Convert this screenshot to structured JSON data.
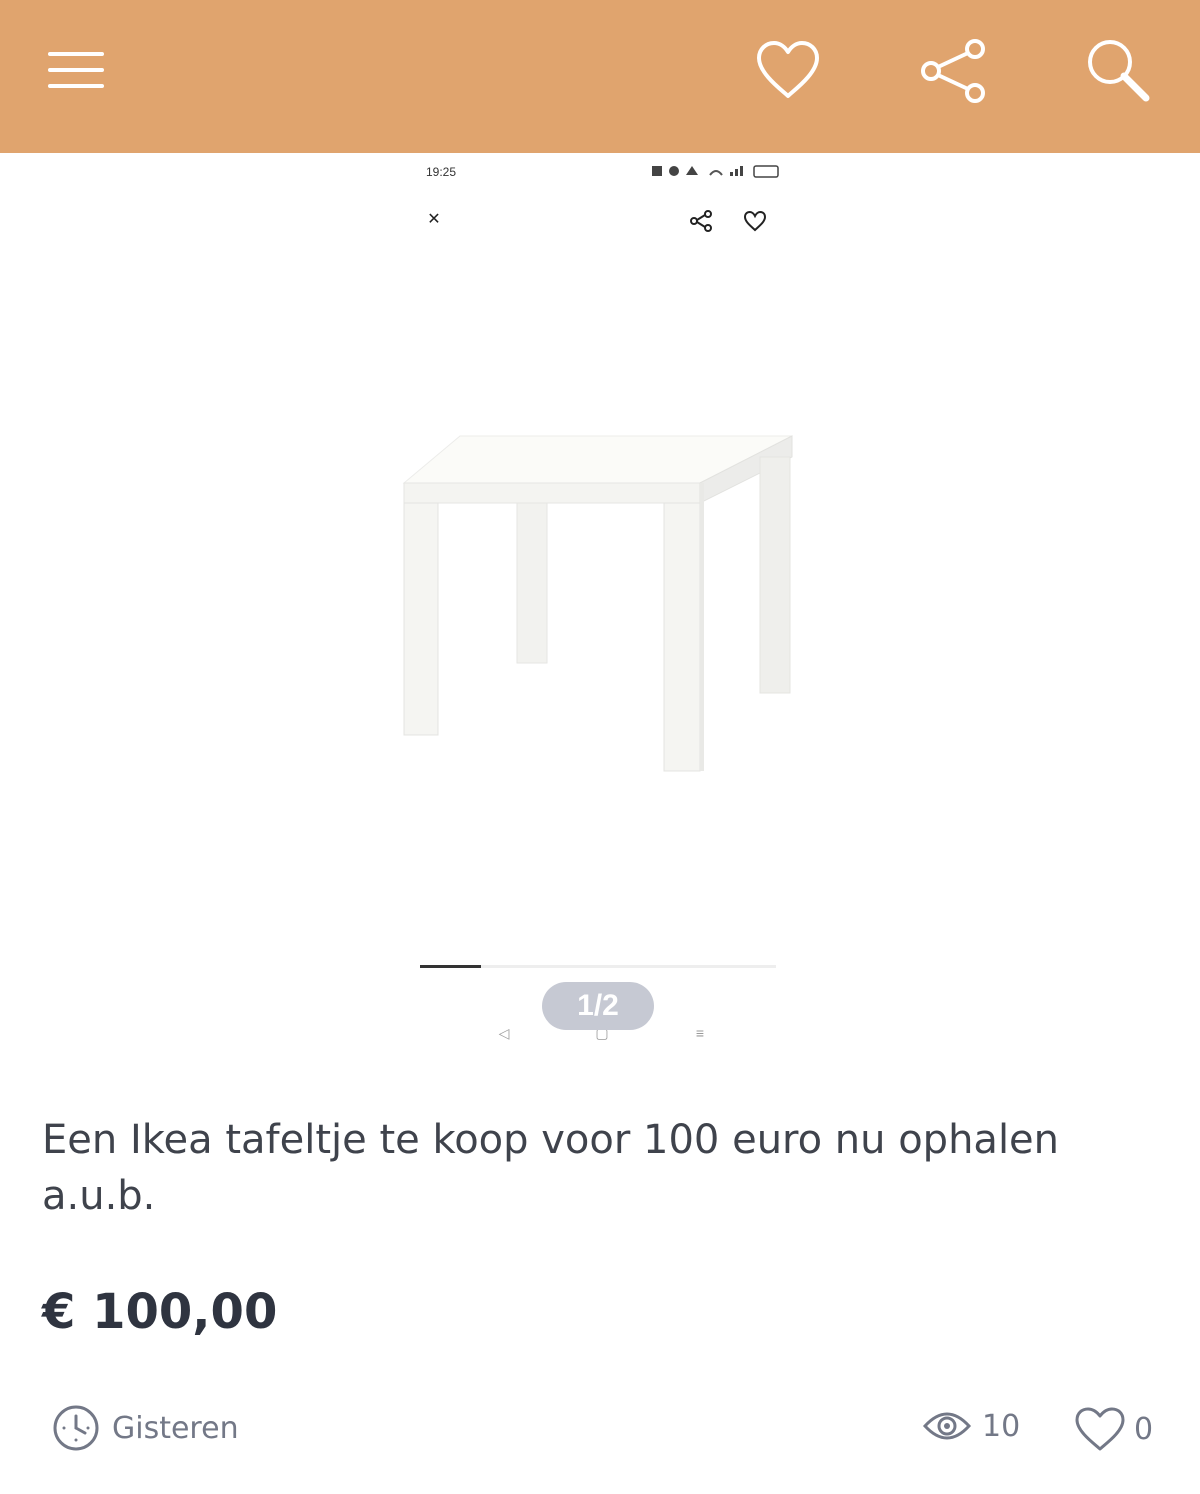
{
  "colors": {
    "header_background": "#e0a46e",
    "header_icons": "#ffffff",
    "text_primary": "#3f434c",
    "text_meta": "#737887",
    "counter_badge": "#c6c9d3"
  },
  "header": {
    "icons": [
      "menu-icon",
      "heart-icon",
      "share-icon",
      "search-icon"
    ]
  },
  "screenshot": {
    "status_time": "19:25",
    "icons": [
      "close-icon",
      "share-icon",
      "heart-icon"
    ],
    "image_progress": 0.17
  },
  "gallery": {
    "counter": "1/2"
  },
  "listing": {
    "title": "Een Ikea tafeltje te koop voor 100 euro nu ophalen a.u.b.",
    "price": "€ 100,00",
    "posted": "Gisteren",
    "views": "10",
    "likes": "0"
  }
}
